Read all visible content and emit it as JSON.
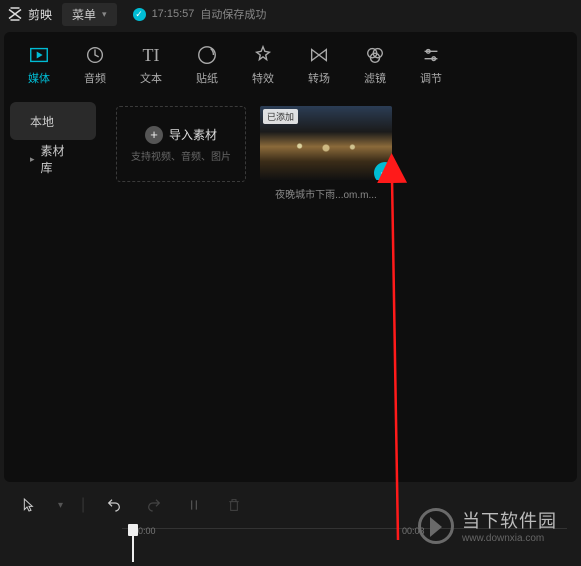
{
  "titlebar": {
    "app_name": "剪映",
    "menu_label": "菜单",
    "autosave_time": "17:15:57",
    "autosave_text": "自动保存成功"
  },
  "toolbar": {
    "items": [
      {
        "label": "媒体",
        "icon": "media"
      },
      {
        "label": "音频",
        "icon": "audio"
      },
      {
        "label": "文本",
        "icon": "text"
      },
      {
        "label": "贴纸",
        "icon": "sticker"
      },
      {
        "label": "特效",
        "icon": "effects"
      },
      {
        "label": "转场",
        "icon": "transition"
      },
      {
        "label": "滤镜",
        "icon": "filter"
      },
      {
        "label": "调节",
        "icon": "adjust"
      }
    ]
  },
  "sidebar": {
    "items": [
      {
        "label": "本地",
        "active": true
      },
      {
        "label": "素材库",
        "active": false
      }
    ]
  },
  "media": {
    "import_label": "导入素材",
    "import_hint": "支持视频、音频、图片",
    "items": [
      {
        "tag": "已添加",
        "caption": "夜晚城市下雨...om.m..."
      }
    ]
  },
  "timeline": {
    "t0": "0:00",
    "t1": "00:03"
  },
  "watermark": {
    "line1": "当下软件园",
    "line2": "www.downxia.com"
  }
}
